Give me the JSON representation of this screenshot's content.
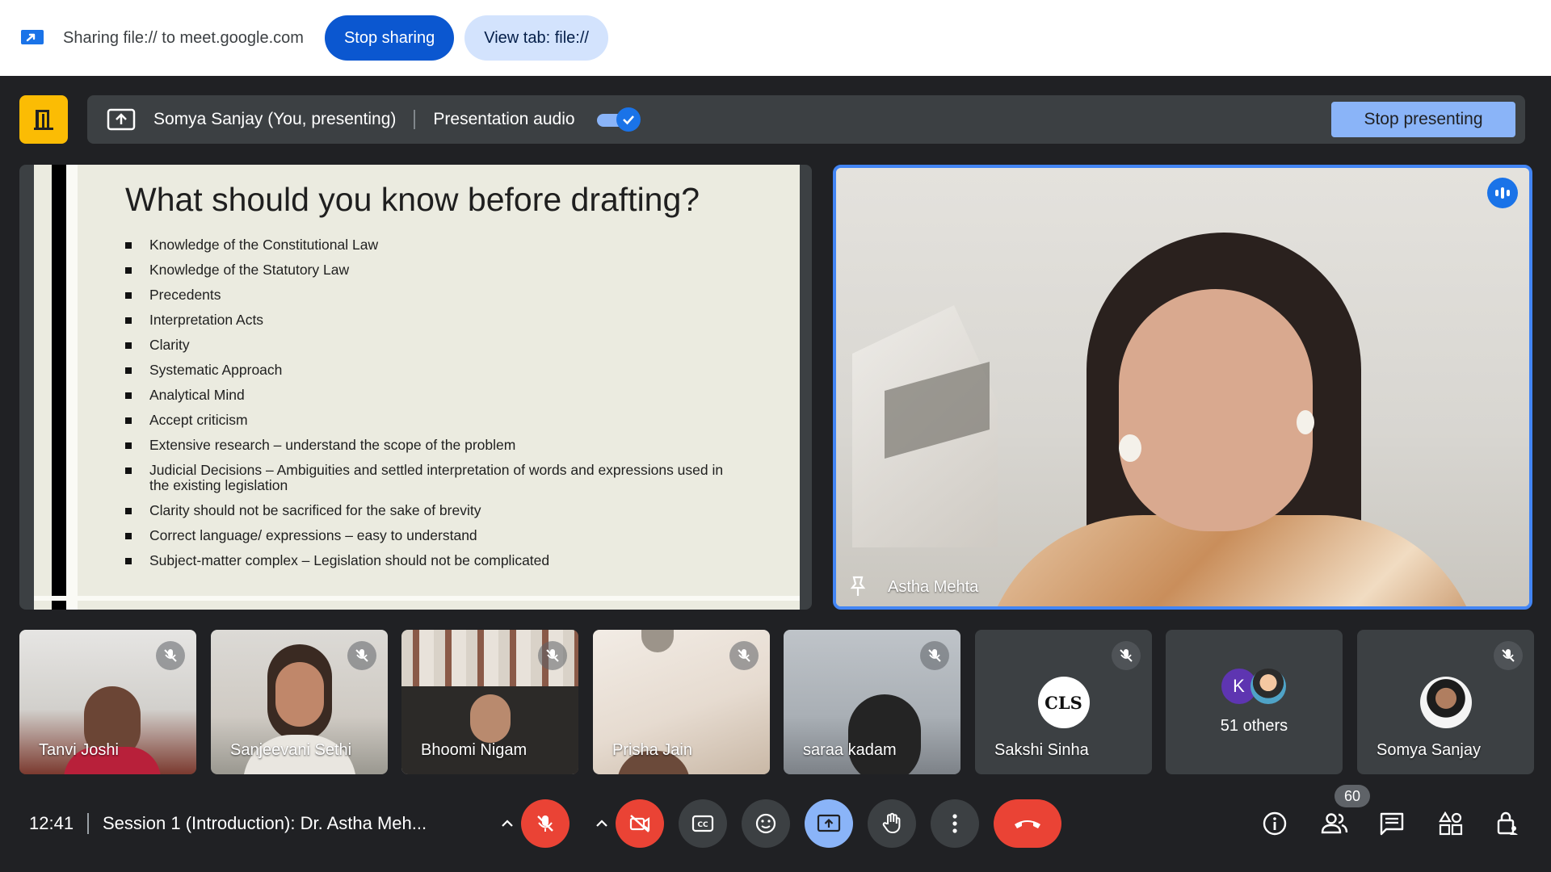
{
  "share_bar": {
    "text": "Sharing file:// to meet.google.com",
    "stop_sharing": "Stop sharing",
    "view_tab": "View tab: file://",
    "icon": "screen-share-icon"
  },
  "present_bar": {
    "presenter": "Somya Sanjay (You, presenting)",
    "audio_label": "Presentation audio",
    "audio_enabled": true,
    "stop_presenting": "Stop presenting",
    "exit_icon": "door-exit-icon"
  },
  "slide": {
    "title": "What should you know before drafting?",
    "bullets": [
      "Knowledge of the Constitutional Law",
      "Knowledge of the Statutory Law",
      "Precedents",
      "Interpretation Acts",
      "Clarity",
      "Systematic Approach",
      "Analytical Mind",
      "Accept criticism",
      "Extensive research – understand the scope of the problem",
      "Judicial Decisions – Ambiguities and settled interpretation of words and expressions used in the existing legislation",
      "Clarity should not be sacrificed for the sake of brevity",
      "Correct language/ expressions – easy to understand",
      "Subject-matter complex – Legislation should not be complicated"
    ]
  },
  "speaker": {
    "name": "Astha Mehta",
    "speaking": true
  },
  "participants": [
    {
      "name": "Tanvi Joshi",
      "muted": true
    },
    {
      "name": "Sanjeevani Sethi",
      "muted": true
    },
    {
      "name": "Bhoomi Nigam",
      "muted": true
    },
    {
      "name": "Prisha Jain",
      "muted": true
    },
    {
      "name": "saraa kadam",
      "muted": true
    },
    {
      "name": "Sakshi Sinha",
      "muted": true,
      "avatar_text": "CLS"
    },
    {
      "name": "51 others",
      "avatar_initial": "K"
    },
    {
      "name": "Somya Sanjay",
      "muted": true
    }
  ],
  "controls": {
    "time": "12:41",
    "meeting_title": "Session 1 (Introduction): Dr. Astha Meh...",
    "people_count": "60",
    "colors": {
      "red": "#ea4335",
      "blue": "#8ab4f8",
      "dark": "#3c4043"
    }
  }
}
